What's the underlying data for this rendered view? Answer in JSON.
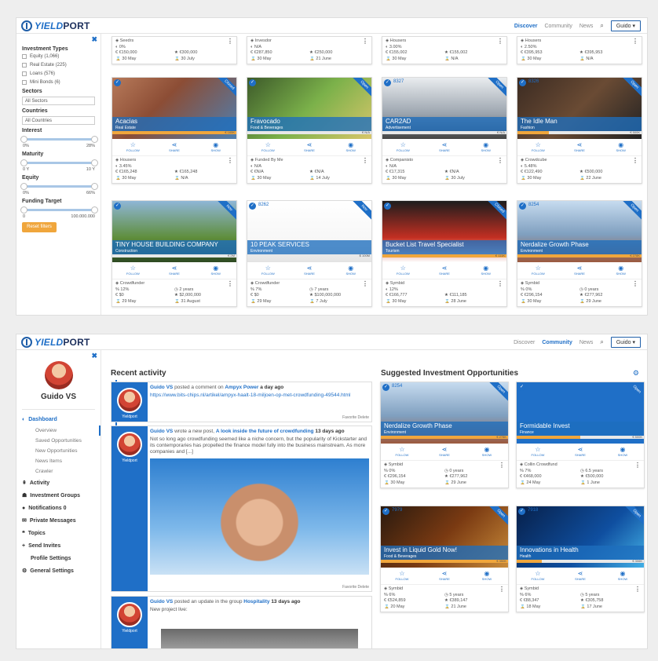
{
  "brand": {
    "name_yield": "YIELD",
    "name_port": "PORT"
  },
  "nav1": {
    "links": [
      "Discover",
      "Community",
      "News"
    ],
    "active": "Discover",
    "user": "Guido ▾"
  },
  "nav2": {
    "links": [
      "Discover",
      "Community",
      "News"
    ],
    "active": "Community",
    "user": "Guido ▾"
  },
  "filters": {
    "investment_types_title": "Investment Types",
    "types": [
      "Equity (1,066)",
      "Real Estate (225)",
      "Loans (576)",
      "Mini Bonds (6)"
    ],
    "sectors_title": "Sectors",
    "sectors_value": "All Sectors",
    "countries_title": "Countries",
    "countries_value": "All Countries",
    "interest_title": "Interest",
    "interest_min": "0%",
    "interest_max": "28%",
    "maturity_title": "Maturity",
    "maturity_min": "0 Y",
    "maturity_max": "10 Y",
    "equity_title": "Equity",
    "equity_min": "0%",
    "equity_max": "66%",
    "funding_title": "Funding Target",
    "funding_min": "0",
    "funding_max": "100.000.000",
    "reset": "Reset filters"
  },
  "actions": {
    "follow": "FOLLOW",
    "share": "SHARE",
    "show": "SHOW"
  },
  "top_stats": [
    {
      "platform": "Seedrs",
      "rate": "0%",
      "raised": "€150,000",
      "target": "€300,000",
      "start": "30 May",
      "end": "30 July"
    },
    {
      "platform": "Invesdor",
      "rate": "N/A",
      "raised": "€287,850",
      "target": "€250,000",
      "start": "30 May",
      "end": "21 June"
    },
    {
      "platform": "Housers",
      "rate": "3.00%",
      "raised": "€155,002",
      "target": "€155,002",
      "start": "30 May",
      "end": "N/A"
    },
    {
      "platform": "Housers",
      "rate": "2.50%",
      "raised": "€395,953",
      "target": "€395,953",
      "start": "30 May",
      "end": "N/A"
    }
  ],
  "cards_row1": [
    {
      "id": "",
      "title": "Acacias",
      "sector": "Real Estate",
      "badge": "Closed",
      "progress": 1.0,
      "progress_label": "€ 165K",
      "platform": "Housers",
      "rate": "3.45%",
      "raised": "€165,248",
      "target": "€165,248",
      "start": "30 May",
      "end": "N/A"
    },
    {
      "id": "",
      "title": "Fravocado",
      "sector": "Food & Beverages",
      "badge": "Open",
      "progress": 0.0,
      "progress_label": "€ N/A",
      "platform": "Funded By Me",
      "rate": "N/A",
      "raised": "€N/A",
      "target": "€N/A",
      "start": "30 May",
      "end": "14 July"
    },
    {
      "id": "8327",
      "title": "CAR2AD",
      "sector": "Advertisement",
      "badge": "Open",
      "progress": 0.0,
      "progress_label": "€ N/A",
      "platform": "Companisto",
      "rate": "N/A",
      "raised": "€17,315",
      "target": "€N/A",
      "start": "30 May",
      "end": "30 July"
    },
    {
      "id": "8326",
      "title": "The Idle Man",
      "sector": "Fashion",
      "badge": "Open",
      "progress": 0.25,
      "progress_label": "€ 500K",
      "platform": "Crowdcube",
      "rate": "5.48%",
      "raised": "€122,490",
      "target": "€500,000",
      "start": "30 May",
      "end": "22 June"
    }
  ],
  "cards_row2": [
    {
      "id": "",
      "title": "TINY HOUSE BUILDING COMPANY",
      "sector": "Construction",
      "badge": "Nov",
      "progress": 0.0,
      "progress_label": "€ 2M",
      "platform": "Crowdfunder",
      "rate": "12%",
      "raised": "$0",
      "target": "$2,000,000",
      "dur_label": "2 years",
      "start": "29 May",
      "end": "31 August"
    },
    {
      "id": "8262",
      "title": "10 PEAK SERVICES",
      "sector": "Environment",
      "badge": "Nov",
      "progress": 0.0,
      "progress_label": "$ 100M",
      "platform": "Crowdfunder",
      "rate": "7%",
      "raised": "$0",
      "target": "$100,000,000",
      "dur_label": "7 years",
      "start": "29 May",
      "end": "7 July"
    },
    {
      "id": "",
      "title": "Bucket List Travel Specialist",
      "sector": "Tourism",
      "badge": "Closed",
      "progress": 1.0,
      "progress_label": "€ 111K",
      "platform": "Symbid",
      "rate": "12%",
      "raised": "€166,777",
      "target": "€111,185",
      "dur_label": "",
      "start": "30 May",
      "end": "28 June"
    },
    {
      "id": "8254",
      "title": "Nerdalize Growth Phase",
      "sector": "Environment",
      "badge": "Open",
      "progress": 1.0,
      "progress_label": "€ 278K",
      "platform": "Symbid",
      "rate": "0%",
      "raised": "€296,154",
      "target": "€277,962",
      "dur_label": "0 years",
      "start": "30 May",
      "end": "29 June"
    }
  ],
  "profile": {
    "name": "Guido VS",
    "menu": {
      "dashboard": "Dashboard",
      "overview": "Overview",
      "saved": "Saved Opportunities",
      "new": "New Opportunities",
      "news": "News Items",
      "crawler": "Crawler",
      "activity": "Activity",
      "groups": "Investment Groups",
      "notifications": "Notifications 0",
      "messages": "Private Messages",
      "topics": "Topics",
      "invites": "Send Invites",
      "profile_settings": "Profile Settings",
      "general": "General Settings"
    }
  },
  "activity": {
    "title": "Recent activity",
    "posts": [
      {
        "who": "Guido VS",
        "action": "posted a comment on",
        "target": "Ampyx Power",
        "when": "a day ago",
        "text": "https://www.bits-chips.nl/artikel/ampyx-haalt-18-miljoen-op-met-crowdfunding-49544.html",
        "foot": "Favorite Delete"
      },
      {
        "who": "Guido VS",
        "action": "wrote a new post,",
        "target": "A look inside the future of crowdfunding",
        "when": "13 days ago",
        "text": "Not so long ago crowdfunding seemed like a niche concern, but the popularity of Kickstarter and its contemporaries has propelled the finance model fully into the business mainstream. As more companies and [...]",
        "foot": "Favorite Delete"
      },
      {
        "who": "Guido VS",
        "action": "posted an update in the group",
        "target": "Hospitality",
        "when": "13 days ago",
        "text": "New project live:",
        "foot": ""
      }
    ],
    "avatar_label": "Yieldport"
  },
  "suggested": {
    "title": "Suggested Investment Opportunities",
    "cards": [
      {
        "id": "8254",
        "title": "Nerdalize Growth Phase",
        "sector": "Environment",
        "badge": "Open",
        "progress": 1.0,
        "progress_label": "€ 278K",
        "platform": "Symbid",
        "rate": "0%",
        "raised": "€296,154",
        "target": "€277,962",
        "dur_label": "0 years",
        "start": "30 May",
        "end": "29 June"
      },
      {
        "id": "",
        "title": "Formidable Invest",
        "sector": "Finance",
        "badge": "Open",
        "progress": 0.5,
        "progress_label": "€ 500K",
        "platform": "Collin Crowdfund",
        "rate": "7%",
        "raised": "€468,000",
        "target": "€500,000",
        "dur_label": "6.5 years",
        "start": "24 May",
        "end": "1 June"
      },
      {
        "id": "7979",
        "title": "Invest in Liquid Gold Now!",
        "sector": "Food & Beverages",
        "badge": "Open",
        "progress": 1.0,
        "progress_label": "€ 350K",
        "platform": "Symbid",
        "rate": "6%",
        "raised": "€524,859",
        "target": "€389,147",
        "dur_label": "5 years",
        "start": "20 May",
        "end": "21 June"
      },
      {
        "id": "7918",
        "title": "Innovations in Health",
        "sector": "Health",
        "badge": "Open",
        "progress": 0.2,
        "progress_label": "€ 306K",
        "platform": "Symbid",
        "rate": "6%",
        "raised": "€88,347",
        "target": "€305,758",
        "dur_label": "5 years",
        "start": "18 May",
        "end": "17 June"
      }
    ]
  }
}
